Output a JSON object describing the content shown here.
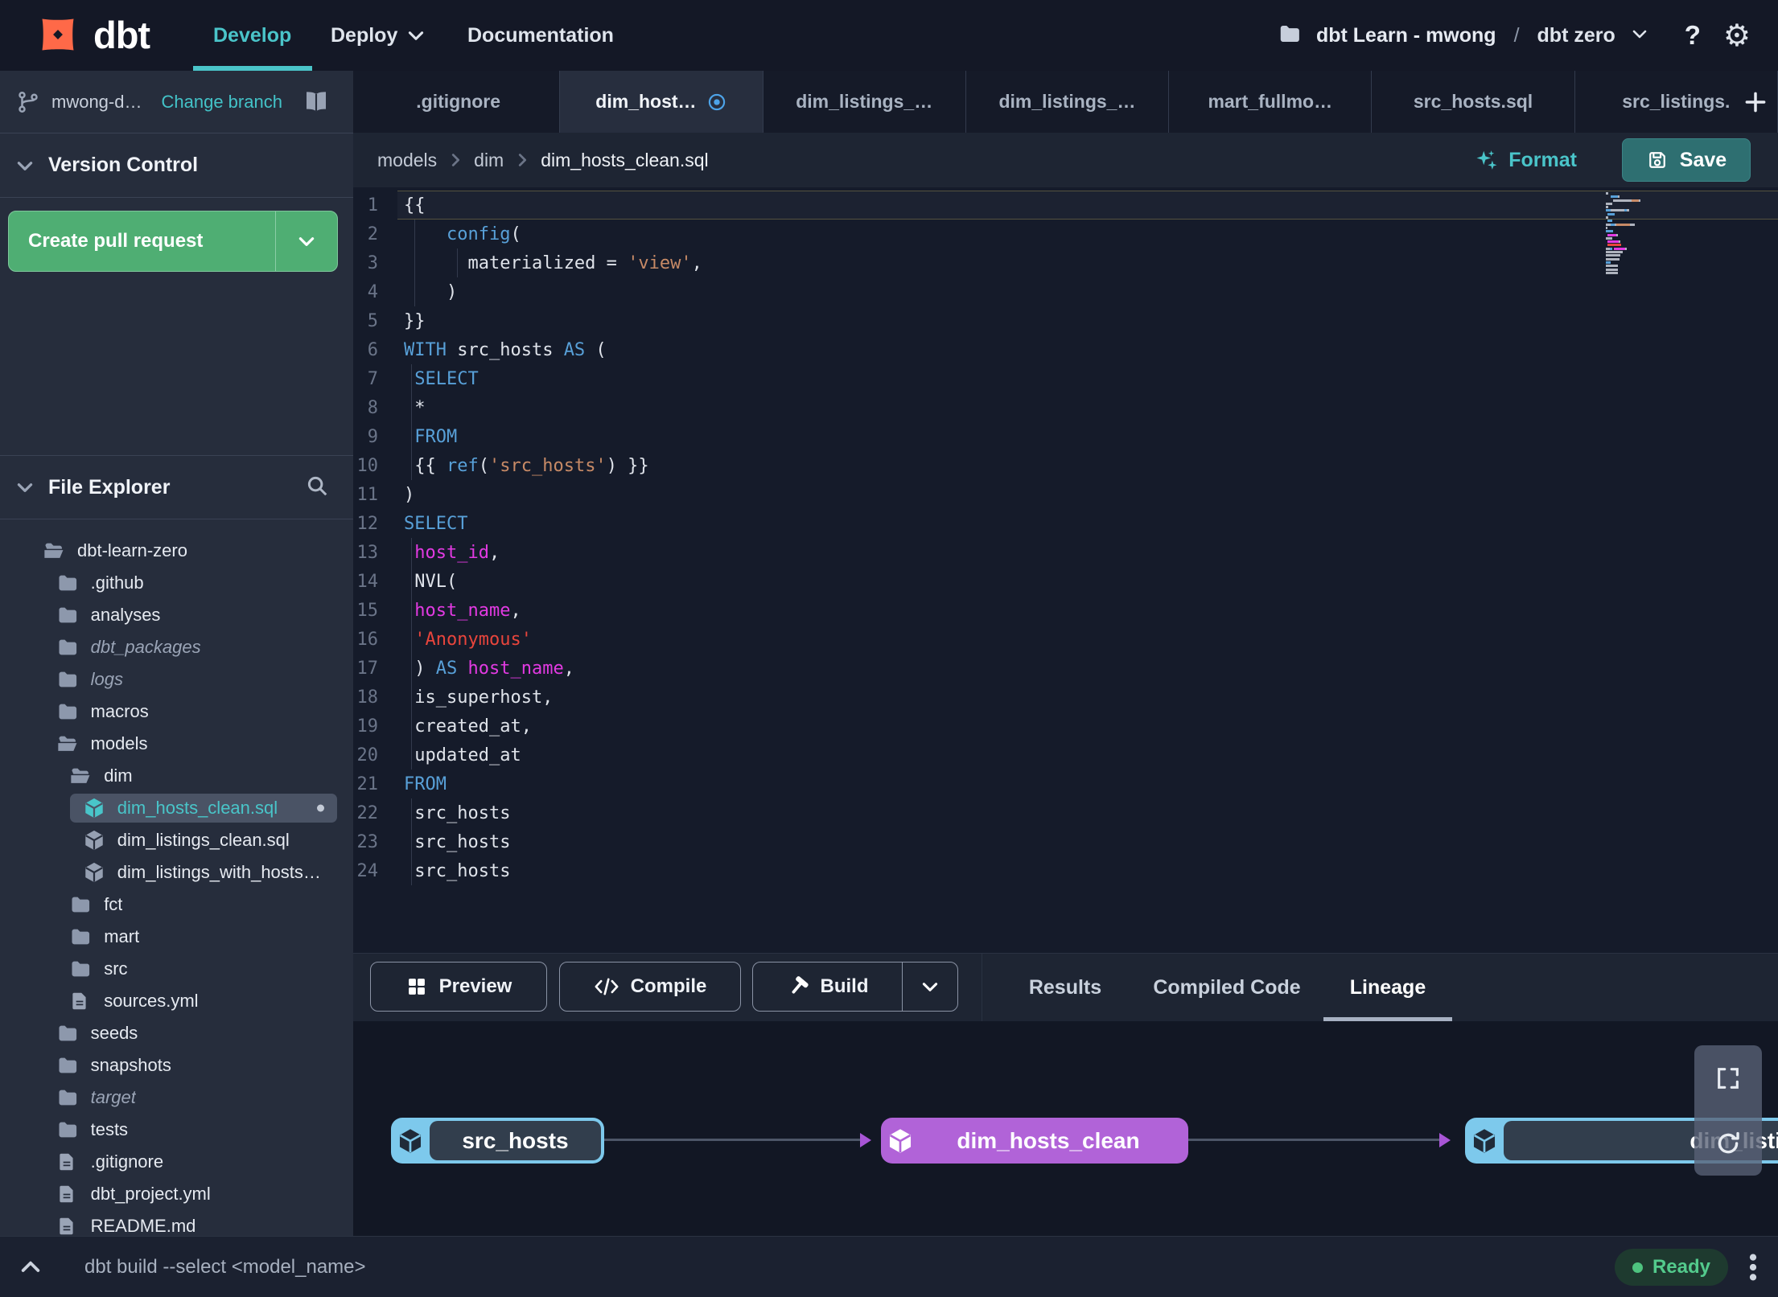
{
  "colors": {
    "accent_teal": "#4ac4c9",
    "green_button": "#4fae73",
    "save_teal": "#2e6f71",
    "keyword_blue": "#58a0d8",
    "string_orange": "#c78a66",
    "error_red": "#e8453c",
    "column_magenta": "#e23ae2",
    "node_blue": "#7dc9ec",
    "node_purple": "#b163d8",
    "ready_green": "#4ec37f",
    "logo_orange": "#ff6948",
    "tab_dot_blue": "#4da3e8"
  },
  "navbar": {
    "logo_text": "dbt",
    "items": [
      {
        "label": "Develop",
        "active": true,
        "caret": false
      },
      {
        "label": "Deploy",
        "active": false,
        "caret": true
      },
      {
        "label": "Documentation",
        "active": false,
        "caret": false
      }
    ],
    "project": "dbt Learn - mwong",
    "separator": "/",
    "environment": "dbt zero",
    "help_label": "?"
  },
  "sidebar": {
    "branch": {
      "name": "mwong-d…",
      "change_link": "Change branch"
    },
    "version_control": {
      "title": "Version Control",
      "create_pr_label": "Create pull request"
    },
    "file_explorer": {
      "title": "File Explorer"
    },
    "tree": [
      {
        "label": "dbt-learn-zero",
        "type": "folder-open",
        "level": 0
      },
      {
        "label": ".github",
        "type": "folder",
        "level": 1
      },
      {
        "label": "analyses",
        "type": "folder",
        "level": 1
      },
      {
        "label": "dbt_packages",
        "type": "folder",
        "level": 1,
        "italic": true
      },
      {
        "label": "logs",
        "type": "folder",
        "level": 1,
        "italic": true
      },
      {
        "label": "macros",
        "type": "folder",
        "level": 1
      },
      {
        "label": "models",
        "type": "folder-open",
        "level": 1
      },
      {
        "label": "dim",
        "type": "folder-open",
        "level": 2
      },
      {
        "label": "dim_hosts_clean.sql",
        "type": "model",
        "level": 3,
        "selected": true,
        "modified": true
      },
      {
        "label": "dim_listings_clean.sql",
        "type": "model",
        "level": 3
      },
      {
        "label": "dim_listings_with_hosts…",
        "type": "model",
        "level": 3
      },
      {
        "label": "fct",
        "type": "folder",
        "level": 2
      },
      {
        "label": "mart",
        "type": "folder",
        "level": 2
      },
      {
        "label": "src",
        "type": "folder",
        "level": 2
      },
      {
        "label": "sources.yml",
        "type": "file",
        "level": 2
      },
      {
        "label": "seeds",
        "type": "folder",
        "level": 1
      },
      {
        "label": "snapshots",
        "type": "folder",
        "level": 1
      },
      {
        "label": "target",
        "type": "folder",
        "level": 1,
        "italic": true
      },
      {
        "label": "tests",
        "type": "folder",
        "level": 1
      },
      {
        "label": ".gitignore",
        "type": "file",
        "level": 1
      },
      {
        "label": "dbt_project.yml",
        "type": "file",
        "level": 1
      },
      {
        "label": "README.md",
        "type": "file",
        "level": 1
      }
    ]
  },
  "tabs": {
    "items": [
      {
        "label": ".gitignore"
      },
      {
        "label": "dim_host…",
        "active": true,
        "modified": true
      },
      {
        "label": "dim_listings_…"
      },
      {
        "label": "dim_listings_…"
      },
      {
        "label": "mart_fullmo…"
      },
      {
        "label": "src_hosts.sql"
      },
      {
        "label": "src_listings."
      }
    ],
    "add_label": "+"
  },
  "editor": {
    "breadcrumb": [
      "models",
      "dim",
      "dim_hosts_clean.sql"
    ],
    "format_label": "Format",
    "save_label": "Save",
    "lines": [
      {
        "n": 1,
        "current": true,
        "tokens": [
          {
            "t": "{{",
            "c": "p"
          }
        ]
      },
      {
        "n": 2,
        "tokens": [
          {
            "t": "    ",
            "c": "p"
          },
          {
            "t": "config",
            "c": "kw"
          },
          {
            "t": "(",
            "c": "p"
          }
        ]
      },
      {
        "n": 3,
        "tokens": [
          {
            "t": "      ",
            "c": "p"
          },
          {
            "t": "materialized",
            "c": "p"
          },
          {
            "t": " = ",
            "c": "p"
          },
          {
            "t": "'view'",
            "c": "str"
          },
          {
            "t": ",",
            "c": "p"
          }
        ]
      },
      {
        "n": 4,
        "tokens": [
          {
            "t": "    )",
            "c": "p"
          }
        ]
      },
      {
        "n": 5,
        "tokens": [
          {
            "t": "}}",
            "c": "p"
          }
        ]
      },
      {
        "n": 6,
        "tokens": [
          {
            "t": "WITH",
            "c": "kw"
          },
          {
            "t": " src_hosts ",
            "c": "p"
          },
          {
            "t": "AS",
            "c": "kw"
          },
          {
            "t": " (",
            "c": "p"
          }
        ]
      },
      {
        "n": 7,
        "tokens": [
          {
            "t": " ",
            "c": "p"
          },
          {
            "t": "SELECT",
            "c": "kw"
          }
        ]
      },
      {
        "n": 8,
        "tokens": [
          {
            "t": " *",
            "c": "p"
          }
        ]
      },
      {
        "n": 9,
        "tokens": [
          {
            "t": " ",
            "c": "p"
          },
          {
            "t": "FROM",
            "c": "kw"
          }
        ]
      },
      {
        "n": 10,
        "tokens": [
          {
            "t": " {{ ",
            "c": "p"
          },
          {
            "t": "ref",
            "c": "kw"
          },
          {
            "t": "(",
            "c": "p"
          },
          {
            "t": "'src_hosts'",
            "c": "str"
          },
          {
            "t": ") }}",
            "c": "p"
          }
        ]
      },
      {
        "n": 11,
        "tokens": [
          {
            "t": ")",
            "c": "p"
          }
        ]
      },
      {
        "n": 12,
        "tokens": [
          {
            "t": "SELECT",
            "c": "kw"
          }
        ]
      },
      {
        "n": 13,
        "tokens": [
          {
            "t": " ",
            "c": "p"
          },
          {
            "t": "host_id",
            "c": "col"
          },
          {
            "t": ",",
            "c": "p"
          }
        ]
      },
      {
        "n": 14,
        "tokens": [
          {
            "t": " NVL(",
            "c": "p"
          }
        ]
      },
      {
        "n": 15,
        "tokens": [
          {
            "t": " ",
            "c": "p"
          },
          {
            "t": "host_name",
            "c": "col"
          },
          {
            "t": ",",
            "c": "p"
          }
        ]
      },
      {
        "n": 16,
        "tokens": [
          {
            "t": " ",
            "c": "p"
          },
          {
            "t": "'Anonymous'",
            "c": "red"
          }
        ]
      },
      {
        "n": 17,
        "tokens": [
          {
            "t": " ) ",
            "c": "p"
          },
          {
            "t": "AS",
            "c": "kw"
          },
          {
            "t": " ",
            "c": "p"
          },
          {
            "t": "host_name",
            "c": "col"
          },
          {
            "t": ",",
            "c": "p"
          }
        ]
      },
      {
        "n": 18,
        "tokens": [
          {
            "t": " is_superhost,",
            "c": "p"
          }
        ]
      },
      {
        "n": 19,
        "tokens": [
          {
            "t": " created_at,",
            "c": "p"
          }
        ]
      },
      {
        "n": 20,
        "tokens": [
          {
            "t": " updated_at",
            "c": "p"
          }
        ]
      },
      {
        "n": 21,
        "tokens": [
          {
            "t": "FROM",
            "c": "kw"
          }
        ]
      },
      {
        "n": 22,
        "tokens": [
          {
            "t": " src_hosts",
            "c": "p"
          }
        ]
      },
      {
        "n": 23,
        "tokens": [
          {
            "t": " src_hosts",
            "c": "p"
          }
        ]
      },
      {
        "n": 24,
        "tokens": [
          {
            "t": " src_hosts",
            "c": "p"
          }
        ]
      }
    ]
  },
  "bottom": {
    "buttons": [
      {
        "label": "Preview",
        "icon": "grid"
      },
      {
        "label": "Compile",
        "icon": "code"
      },
      {
        "label": "Build",
        "icon": "hammer",
        "split": true
      }
    ],
    "tabs": [
      {
        "label": "Results"
      },
      {
        "label": "Compiled Code"
      },
      {
        "label": "Lineage",
        "active": true
      }
    ]
  },
  "lineage": {
    "nodes": [
      {
        "label": "src_hosts",
        "style": "source"
      },
      {
        "label": "dim_hosts_clean",
        "style": "model"
      },
      {
        "label": "dim_listings_with_hosts",
        "style": "source"
      }
    ]
  },
  "statusbar": {
    "command": "dbt build --select <model_name>",
    "status": "Ready"
  }
}
